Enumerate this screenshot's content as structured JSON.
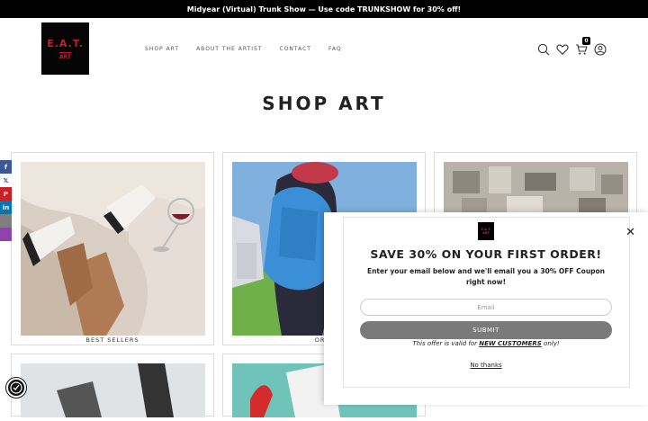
{
  "announcement": {
    "text": "Midyear (Virtual) Trunk Show — Use code TRUNKSHOW for 30% off!"
  },
  "header": {
    "logo_line1": "E.A.T.",
    "logo_line2": "ART",
    "nav": [
      "SHOP ART",
      "ABOUT THE ARTIST",
      "CONTACT",
      "FAQ"
    ],
    "cart_count": "0",
    "icons": [
      "search-icon",
      "heart-icon",
      "cart-icon",
      "account-icon"
    ]
  },
  "page": {
    "title": "SHOP ART"
  },
  "collections": [
    {
      "caption": "BEST SELLERS"
    },
    {
      "caption": "ORIG"
    },
    {
      "caption": ""
    },
    {
      "caption": ""
    },
    {
      "caption": ""
    }
  ],
  "social": [
    "facebook-icon",
    "x-icon",
    "pinterest-icon",
    "linkedin-icon",
    "email-icon",
    "more-icon"
  ],
  "popup": {
    "logo_line1": "E.A.T.",
    "logo_line2": "ART",
    "title": "SAVE 30% ON YOUR FIRST ORDER!",
    "description": "Enter your email below and we'll email you a 30% OFF Coupon right now!",
    "email_placeholder": "Email",
    "submit_label": "SUBMIT",
    "note_prefix": "This offer is valid for ",
    "note_highlight": "NEW CUSTOMERS",
    "note_suffix": " only!",
    "no_thanks": "No thanks",
    "close_symbol": "✕"
  },
  "colors": {
    "announcement_bg": "#000000",
    "logo_red": "#c8202a",
    "submit_bg": "#7a7a7a"
  }
}
